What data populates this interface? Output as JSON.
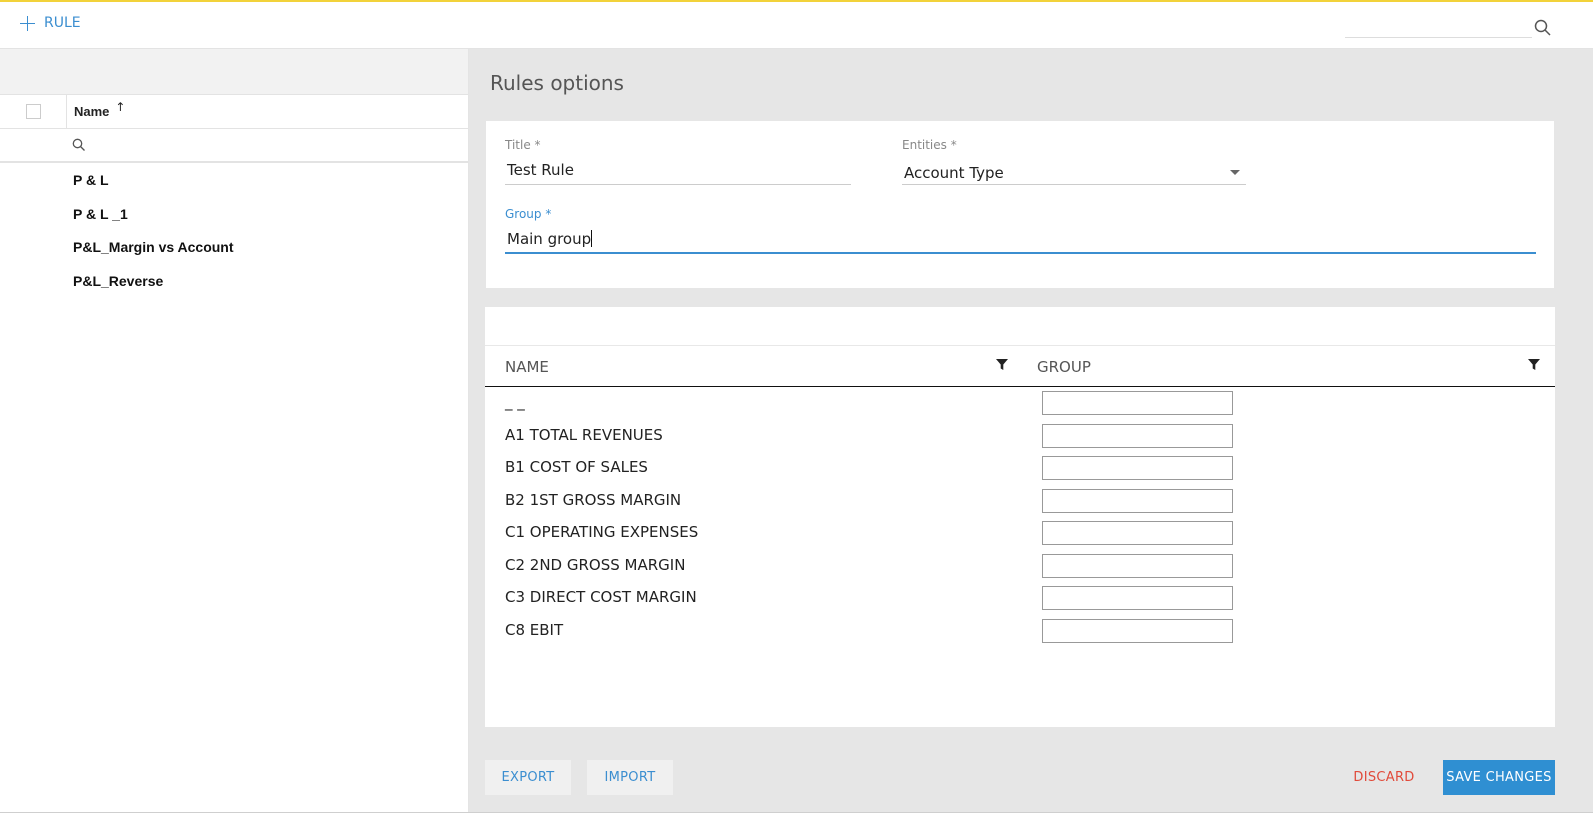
{
  "toolbar": {
    "add_rule_label": "RULE",
    "search_placeholder": ""
  },
  "left_panel": {
    "column_header": "Name",
    "sort_indicator": "↑",
    "filter_placeholder": "",
    "rules": [
      {
        "label": "P & L"
      },
      {
        "label": "P & L _1"
      },
      {
        "label": "P&L_Margin vs Account"
      },
      {
        "label": "P&L_Reverse"
      }
    ]
  },
  "main": {
    "title": "Rules options",
    "form": {
      "title_label": "Title *",
      "title_value": "Test Rule",
      "entities_label": "Entities *",
      "entities_value": "Account Type",
      "group_label": "Group *",
      "group_value": "Main group"
    },
    "table": {
      "col_name": "NAME",
      "col_group": "GROUP",
      "rows": [
        {
          "name": "_ _",
          "group": ""
        },
        {
          "name": "A1 TOTAL REVENUES",
          "group": ""
        },
        {
          "name": "B1 COST OF SALES",
          "group": ""
        },
        {
          "name": "B2 1ST GROSS MARGIN",
          "group": ""
        },
        {
          "name": "C1 OPERATING EXPENSES",
          "group": ""
        },
        {
          "name": "C2 2ND GROSS MARGIN",
          "group": ""
        },
        {
          "name": "C3 DIRECT COST MARGIN",
          "group": ""
        },
        {
          "name": "C8 EBIT",
          "group": ""
        }
      ]
    },
    "footer": {
      "export_label": "EXPORT",
      "import_label": "IMPORT",
      "discard_label": "DISCARD",
      "save_label": "SAVE CHANGES"
    }
  },
  "colors": {
    "accent": "#3b8ed0",
    "save_button": "#2f8fd2",
    "discard": "#e14a3a",
    "top_border": "#f2d23a",
    "panel_background": "#e6e6e6"
  },
  "icons": {
    "add": "plus-icon",
    "search": "search-icon",
    "filter": "filter-icon",
    "dropdown": "caret-down-icon"
  }
}
